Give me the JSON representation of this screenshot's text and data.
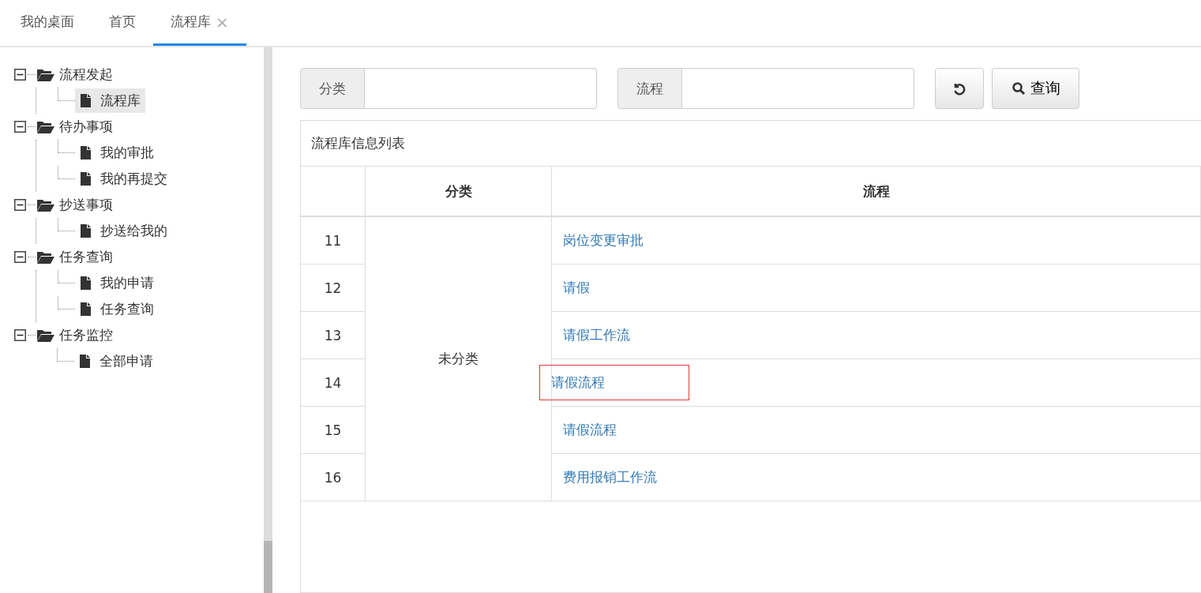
{
  "tabs": [
    {
      "label": "我的桌面",
      "selected": false
    },
    {
      "label": "首页",
      "selected": false
    },
    {
      "label": "流程库",
      "selected": true,
      "close": "×"
    }
  ],
  "tree": [
    {
      "label": "流程发起",
      "expanded": true,
      "children": [
        {
          "label": "流程库",
          "selected": true
        }
      ]
    },
    {
      "label": "待办事项",
      "expanded": true,
      "children": [
        {
          "label": "我的审批",
          "selected": false
        },
        {
          "label": "我的再提交",
          "selected": false
        }
      ]
    },
    {
      "label": "抄送事项",
      "expanded": true,
      "children": [
        {
          "label": "抄送给我的",
          "selected": false
        }
      ]
    },
    {
      "label": "任务查询",
      "expanded": true,
      "children": [
        {
          "label": "我的申请",
          "selected": false
        },
        {
          "label": "任务查询",
          "selected": false
        }
      ]
    },
    {
      "label": "任务监控",
      "expanded": true,
      "children": [
        {
          "label": "全部申请",
          "selected": false
        }
      ]
    }
  ],
  "filters": [
    {
      "label": "分类"
    },
    {
      "label": "流程"
    }
  ],
  "search_button": {
    "label": "查询"
  },
  "table": {
    "title": "流程库信息列表",
    "columns": [
      "分类",
      "流程"
    ],
    "groups": [
      {
        "category": "未分类",
        "rows": [
          {
            "index": "11",
            "process": "岗位变更审批",
            "highlighted": false
          },
          {
            "index": "12",
            "process": "请假",
            "highlighted": false
          },
          {
            "index": "13",
            "process": "请假工作流",
            "highlighted": false
          },
          {
            "index": "14",
            "process": "请假流程",
            "highlighted": true
          },
          {
            "index": "15",
            "process": "请假流程",
            "highlighted": false
          },
          {
            "index": "16",
            "process": "费用报销工作流",
            "highlighted": false
          }
        ]
      }
    ]
  }
}
